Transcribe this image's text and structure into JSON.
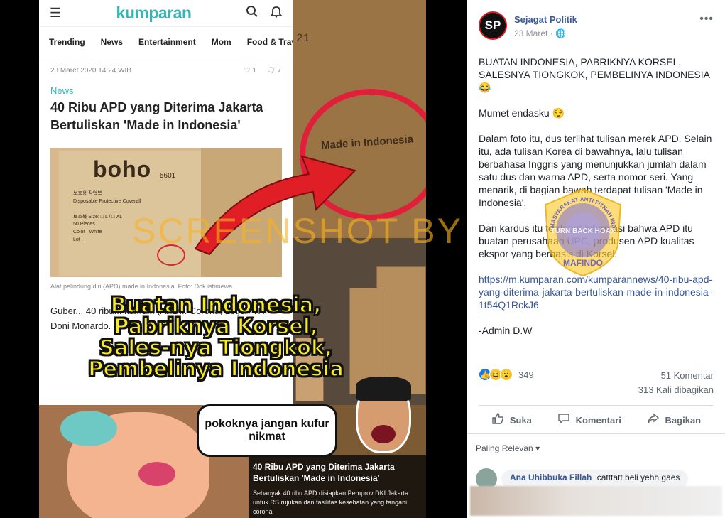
{
  "kumparan": {
    "logo": "kumparan",
    "nav": [
      "Trending",
      "News",
      "Entertainment",
      "Mom",
      "Food & Travel"
    ],
    "date": "23 Maret 2020 14:24 WIB",
    "likes": "1",
    "comments": "7",
    "category": "News",
    "title": "40 Ribu APD yang Diterima Jakarta Bertuliskan 'Made in Indonesia'",
    "photo": {
      "brand": "boho",
      "number": "5601",
      "lines": "보호용 작업복\nDisposable Protective Coverall\n\n보호복 Size: □ L / □ XL\n50 Pieces\nColor : White\nLot :",
      "made_in": "Made in Indonesia"
    },
    "caption": "Alat pelindung diri (APD) made in Indonesia. Foto: Dok istimewa",
    "body": "Guber... 40 ribu... komu... (APD... Corona, Letjen TNI Doni Monardo."
  },
  "closeup": {
    "number": "21",
    "made_in": "Made in Indonesia"
  },
  "meme": {
    "lines": [
      "Buatan Indonesia,",
      "Pabriknya Korsel,",
      "Sales-nya Tiongkok,",
      "Pembelinya Indonesia"
    ],
    "bubble": "pokoknya jangan kufur nikmat"
  },
  "news_strip": {
    "title": "40 Ribu APD yang Diterima Jakarta Bertuliskan 'Made in Indonesia'",
    "subtitle": "Sebanyak 40 ribu APD disiapkan Pemprov DKI Jakarta untuk RS rujukan dan fasilitas kesehatan yang tangani corona"
  },
  "watermark": "SCREENSHOT BY",
  "stamp": {
    "ring_text": "MASYARAKAT ANTI FITNAH INDONESIA",
    "org": "MAFINDO",
    "center": "TURN BACK HOAX"
  },
  "facebook": {
    "page_name": "Sejagat Politik",
    "avatar_text": "SP",
    "date": "23 Maret",
    "post": [
      "BUATAN INDONESIA, PABRIKNYA KORSEL, SALESNYA TIONGKOK, PEMBELINYA INDONESIA 😂",
      "Mumet endasku 😌",
      "Dalam foto itu, dus terlihat tulisan merek APD. Selain itu, ada tulisan Korea di bawahnya, lalu tulisan berbahasa Inggris yang menunjukkan jumlah dalam satu dus dan warna APD, serta nomor seri. Yang menarik, di bagian bawah terdapat tulisan 'Made in Indonesia'.",
      "Dari kardus itu terdapat informasi bahwa APD itu buatan perusahaan UPC, produsen APD kualitas ekspor yang berbasis di Korsel.",
      "https://m.kumparan.com/kumparannews/40-ribu-apd-yang-diterima-jakarta-bertuliskan-made-in-indonesia-1t54Q1RckJ6",
      "-Admin D.W"
    ],
    "reaction_count": "349",
    "comments_count": "51 Komentar",
    "shares_count": "313 Kali dibagikan",
    "actions": {
      "like": "Suka",
      "comment": "Komentari",
      "share": "Bagikan"
    },
    "sort_label": "Paling Relevan",
    "comment": {
      "name": "Ana Uhibbuka Fillah",
      "text": "catttatt beli yehh gaes"
    },
    "colors": {
      "link": "#385898",
      "text": "#1d2129",
      "muted": "#606770"
    }
  }
}
